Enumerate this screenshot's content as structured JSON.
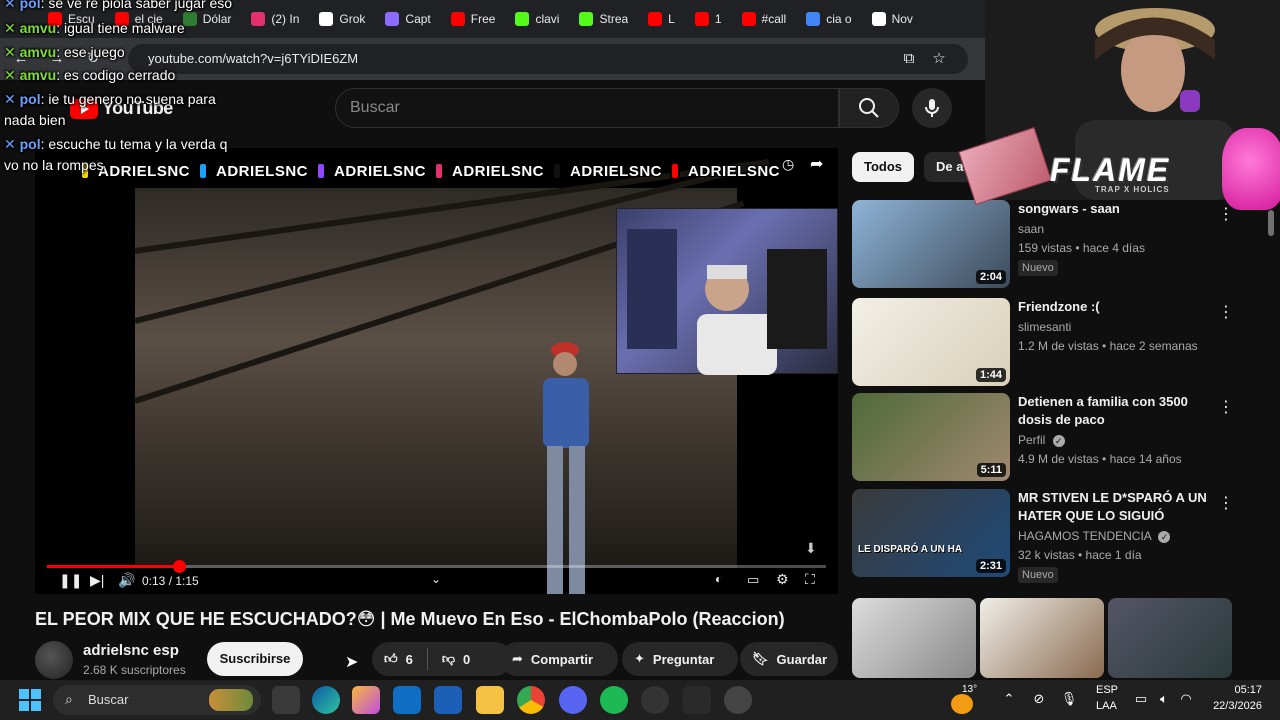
{
  "browser": {
    "tabs": [
      {
        "label": "Escu",
        "color": "#ff0000"
      },
      {
        "label": "el cie",
        "color": "#ff0000"
      },
      {
        "label": "Dólar",
        "color": "#2e7d32"
      },
      {
        "label": "(2) In",
        "color": "#e1306c"
      },
      {
        "label": "Grok",
        "color": "#ffffff"
      },
      {
        "label": "Capt",
        "color": "#8e6bff"
      },
      {
        "label": "Free",
        "color": "#ff0000"
      },
      {
        "label": "clavi",
        "color": "#53fc18"
      },
      {
        "label": "Strea",
        "color": "#53fc18"
      },
      {
        "label": "L",
        "color": "#ff0000"
      },
      {
        "label": "1",
        "color": "#ff0000"
      },
      {
        "label": "#call",
        "color": "#ff0000"
      },
      {
        "label": "cia o",
        "color": "#4285f4"
      },
      {
        "label": "Nov",
        "color": "#ffffff"
      }
    ],
    "url": "youtube.com/watch?v=j6TYiDIE6ZM"
  },
  "chat": [
    {
      "user": "pol",
      "text": ": se ve re piola saber jugar eso",
      "color": "#6aa0ff"
    },
    {
      "user": "amvu",
      "text": ": igual tiene malware",
      "color": "#7fdc3a"
    },
    {
      "user": "amvu",
      "text": ": ese juego",
      "color": "#7fdc3a"
    },
    {
      "user": "amvu",
      "text": ": es codigo cerrado",
      "color": "#7fdc3a"
    },
    {
      "user": "pol",
      "text": ": ie tu genero no suena para",
      "color": "#6aa0ff"
    },
    {
      "user": "",
      "text": "nada bien",
      "color": "#ffffff"
    },
    {
      "user": "pol",
      "text": ": escuche tu tema y la verda q",
      "color": "#6aa0ff"
    },
    {
      "user": "",
      "text": "vo no la rompes",
      "color": "#ffffff"
    }
  ],
  "youtube": {
    "logo": "YouTube",
    "search_placeholder": "Buscar"
  },
  "player": {
    "banner": [
      "ADRIELSNC",
      "ADRIELSNC",
      "ADRIELSNC",
      "ADRIELSNC",
      "ADRIELSNC",
      "ADRIELSNC"
    ],
    "time": "0:13 / 1:15",
    "progress_fraction": 0.17
  },
  "video": {
    "title": "EL PEOR MIX QUE HE ESCUCHADO?😳 | Me Muevo En Eso - ElChombaPolo (Reaccion)",
    "channel": "adrielsnc esp",
    "subscribers": "2.68 K suscriptores",
    "subscribe_label": "Suscribirse",
    "likes": "6",
    "dislikes": "0",
    "share_label": "Compartir",
    "ask_label": "Preguntar",
    "save_label": "Guardar"
  },
  "sidebar": {
    "chips": [
      "Todos",
      "De adriel"
    ],
    "recommendations": [
      {
        "title": "songwars - saan",
        "channel": "saan",
        "meta": "159 vistas • hace 4 días",
        "duration": "2:04",
        "badge": "Nuevo",
        "verified": false
      },
      {
        "title": "Friendzone :(",
        "channel": "slimesanti",
        "meta": "1.2 M de vistas • hace 2 semanas",
        "duration": "1:44",
        "badge": "",
        "verified": false
      },
      {
        "title": "Detienen a familia con 3500 dosis de paco",
        "channel": "Perfil",
        "meta": "4.9 M de vistas • hace 14 años",
        "duration": "5:11",
        "badge": "",
        "verified": true
      },
      {
        "title": "MR STIVEN LE D*SPARÓ A UN HATER QUE LO SIGUIÓ",
        "channel": "HAGAMOS TENDENCIA",
        "meta": "32 k vistas • hace 1 día",
        "duration": "2:31",
        "badge": "Nuevo",
        "verified": true,
        "thumb_text": "LE DISPARÓ A UN HA"
      }
    ]
  },
  "streamer": {
    "logo": "FLAME",
    "sub": "TRAP X HOLICS"
  },
  "taskbar": {
    "search_placeholder": "Buscar",
    "temperature": "13°",
    "lang1": "ESP",
    "lang2": "LAA",
    "time": "05:17",
    "date": "22/3/2026"
  }
}
